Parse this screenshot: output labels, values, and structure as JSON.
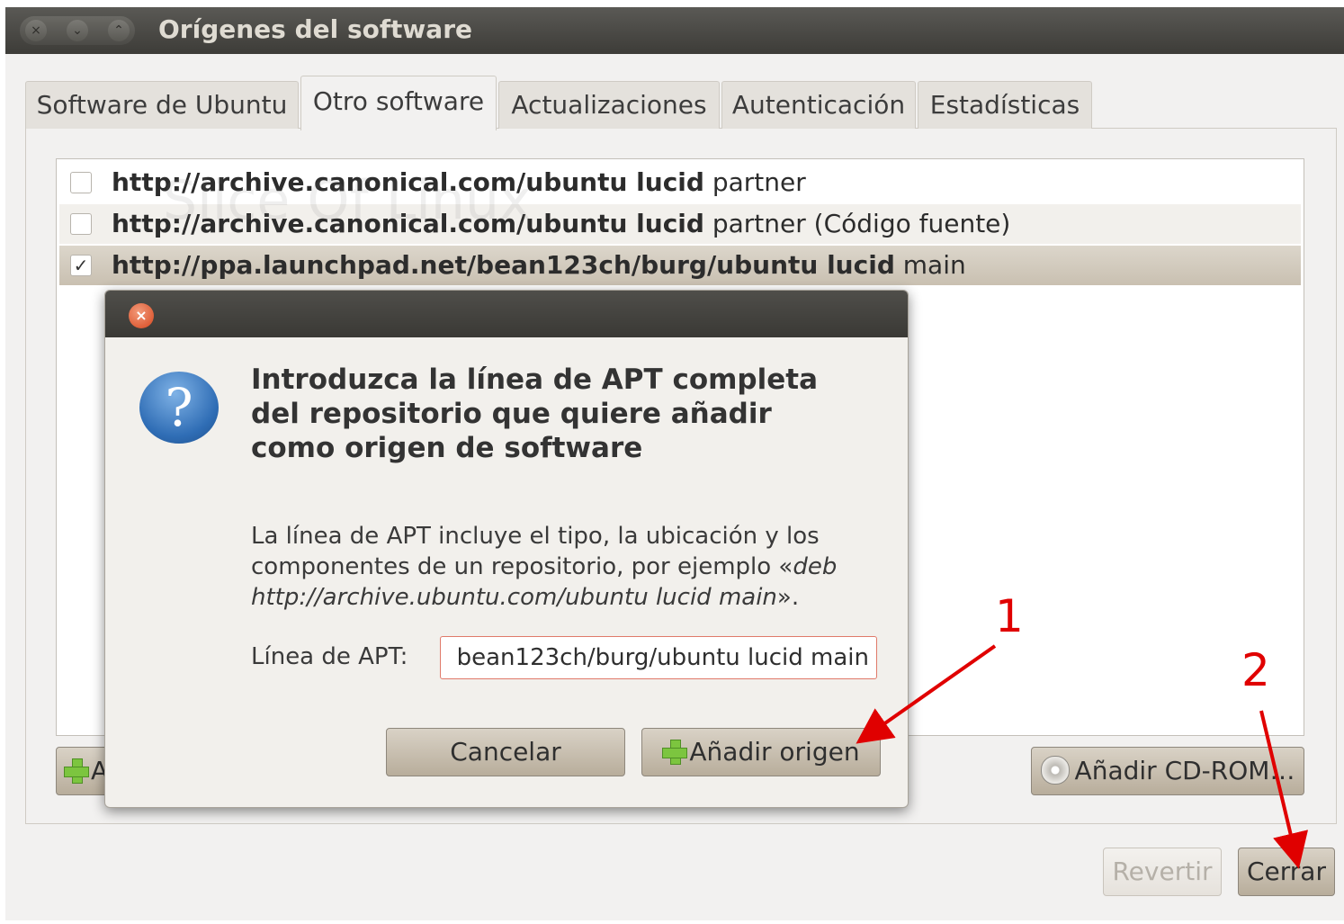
{
  "window": {
    "title": "Orígenes del software",
    "controls": [
      "×",
      "⌄",
      "⌃"
    ]
  },
  "tabs": [
    {
      "label": "Software de Ubuntu",
      "active": false
    },
    {
      "label": "Otro software",
      "active": true
    },
    {
      "label": "Actualizaciones",
      "active": false
    },
    {
      "label": "Autenticación",
      "active": false
    },
    {
      "label": "Estadísticas",
      "active": false
    }
  ],
  "sources": [
    {
      "checked": false,
      "url": "http://archive.canonical.com/ubuntu lucid",
      "component": "partner"
    },
    {
      "checked": false,
      "url": "http://archive.canonical.com/ubuntu lucid",
      "component": "partner (Código fuente)"
    },
    {
      "checked": true,
      "url": "http://ppa.launchpad.net/bean123ch/burg/ubuntu lucid",
      "component": "main"
    }
  ],
  "watermark": "Slice Of Linux",
  "buttons": {
    "add": "Añadir…",
    "add_cdrom": "Añadir CD-ROM…",
    "revert": "Revertir",
    "close": "Cerrar"
  },
  "dialog": {
    "close_glyph": "×",
    "icon": "question-icon",
    "heading": "Introduzca la línea de APT completa del repositorio que quiere añadir como origen de software",
    "body_plain": "La línea de APT incluye el tipo, la ubicación y los componentes de un repositorio, por ejemplo «",
    "body_example": "deb http://archive.ubuntu.com/ubuntu lucid main",
    "body_end": "».",
    "apt_label": "Línea de APT:",
    "apt_value": "bean123ch/burg/ubuntu lucid main",
    "cancel": "Cancelar",
    "add_source": "Añadir origen"
  },
  "annotations": [
    "1",
    "2"
  ],
  "colors": {
    "accent_arrow": "#e00000",
    "titlebar": "#3d3c38",
    "window_bg": "#f2f1f0"
  }
}
